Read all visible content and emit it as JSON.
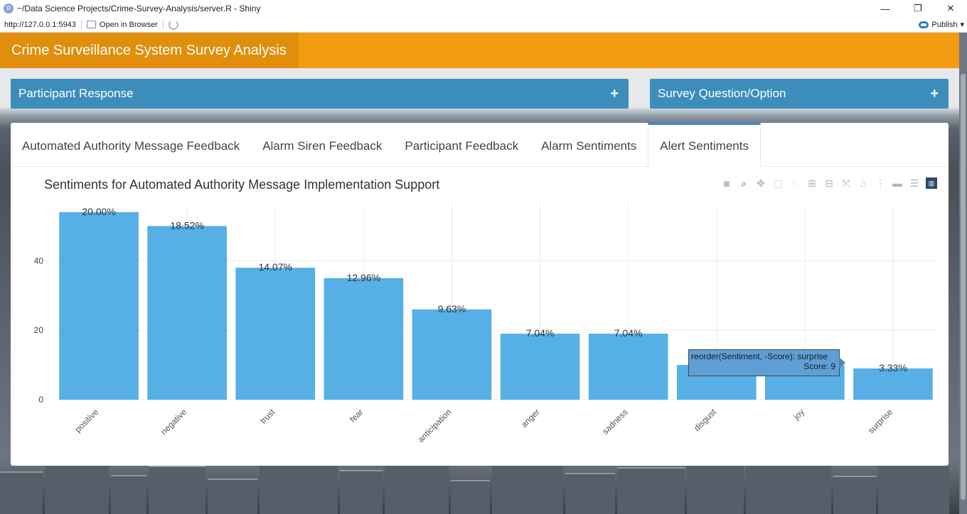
{
  "window": {
    "title": "~/Data Science Projects/Crime-Survey-Analysis/server.R - Shiny",
    "app_icon": "R",
    "minimize": "—",
    "maximize": "❐",
    "close": "✕"
  },
  "toolbar": {
    "url": "http://127.0.0.1:5943",
    "open_in_browser": "Open in Browser",
    "publish": "Publish"
  },
  "app": {
    "title": "Crime Surveillance System Survey Analysis",
    "header_color": "#f39c12",
    "panels": [
      {
        "label": "Participant Response",
        "toggle": "+"
      },
      {
        "label": "Survey Question/Option",
        "toggle": "+"
      }
    ],
    "tabs": [
      {
        "label": "Automated Authority Message Feedback"
      },
      {
        "label": "Alarm Siren Feedback"
      },
      {
        "label": "Participant Feedback"
      },
      {
        "label": "Alarm Sentiments"
      },
      {
        "label": "Alert Sentiments",
        "active": true
      }
    ]
  },
  "modebar": [
    "camera-icon",
    "zoom-icon",
    "pan-icon",
    "box-select-icon",
    "lasso-icon",
    "zoom-in-icon",
    "zoom-out-icon",
    "autoscale-icon",
    "reset-icon",
    "spike-icon",
    "hover-closest-icon",
    "hover-compare-icon",
    "plotly-logo-icon"
  ],
  "chart_data": {
    "type": "bar",
    "title": "Sentiments for Automated Authority Message Implementation Support",
    "categories": [
      "positive",
      "negative",
      "trust",
      "fear",
      "anticipation",
      "anger",
      "sadness",
      "disgust",
      "joy",
      "surprise"
    ],
    "values": [
      54,
      50,
      38,
      35,
      26,
      19,
      19,
      10,
      10,
      9
    ],
    "labels": [
      "20.00%",
      "18.52%",
      "14.07%",
      "12.96%",
      "9.63%",
      "7.04%",
      "7.04%",
      "",
      "",
      "3.33%"
    ],
    "yticks": [
      "0",
      "20",
      "40"
    ],
    "ylim": [
      0,
      56
    ],
    "grid": true,
    "bar_color": "#56b0e6",
    "tooltip": {
      "line1": "reorder(Sentiment, -Score): surprise",
      "line2": "Score:  9"
    }
  }
}
